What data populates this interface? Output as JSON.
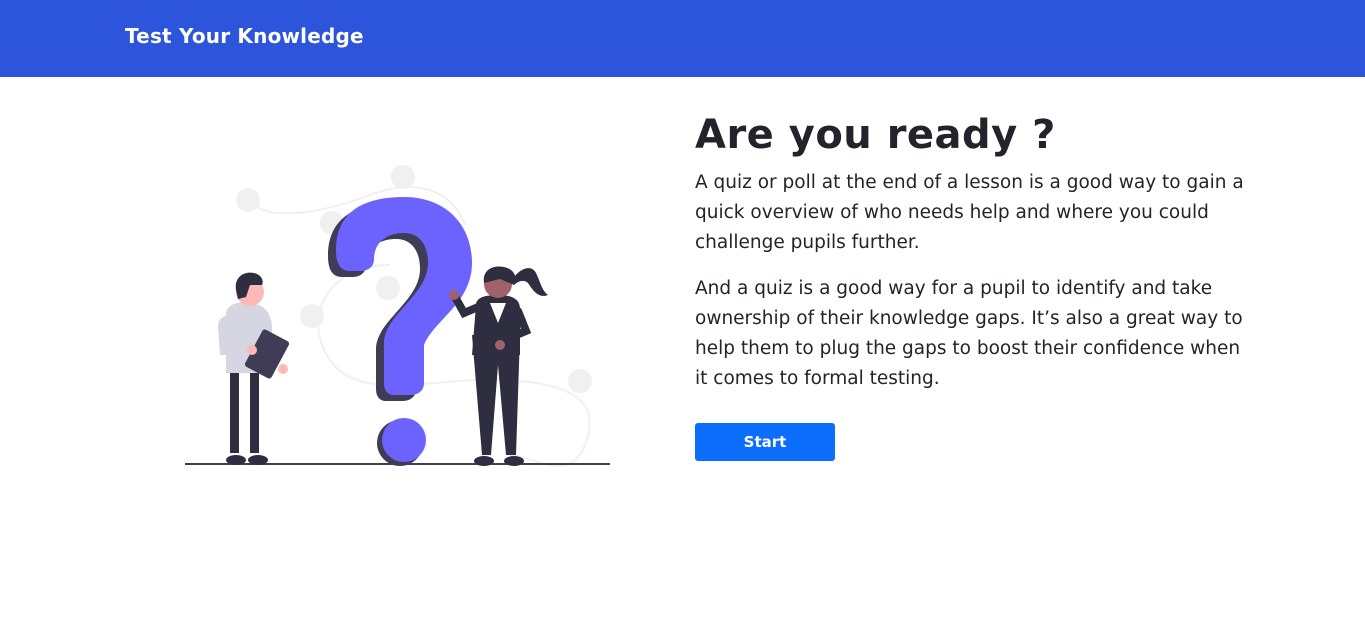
{
  "navbar": {
    "brand": "Test Your Knowledge",
    "background_color": "#2c55db"
  },
  "illustration": {
    "icon": "question-mark-people-illustration",
    "accent_color": "#6c63ff"
  },
  "main": {
    "heading": "Are you ready ?",
    "paragraph_1": "A quiz or poll at the end of a lesson is a good way to gain a quick overview of who needs help and where you could challenge pupils further.",
    "paragraph_2": "And a quiz is a good way for a pupil to identify and take ownership of their knowledge gaps. It’s also a great way to help them to plug the gaps to boost their confidence when it comes to formal testing.",
    "start_label": "Start",
    "button_color": "#0d6efd"
  }
}
